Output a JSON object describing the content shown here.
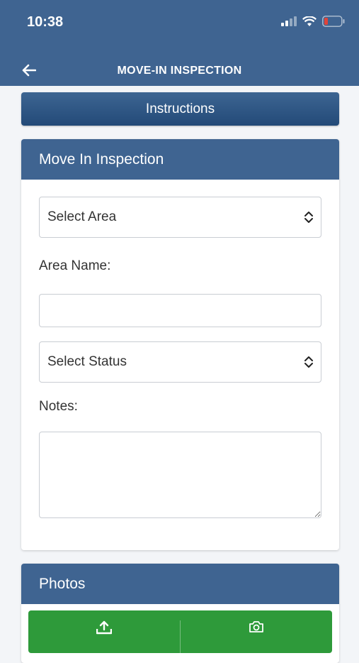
{
  "status_bar": {
    "time": "10:38"
  },
  "nav": {
    "title": "MOVE-IN INSPECTION",
    "back_icon": "back-arrow-icon"
  },
  "instructions_label": "Instructions",
  "inspection": {
    "title": "Move In Inspection",
    "area_select_value": "Select Area",
    "area_name_label": "Area Name:",
    "area_name_value": "",
    "status_select_value": "Select Status",
    "notes_label": "Notes:",
    "notes_value": ""
  },
  "photos": {
    "title": "Photos",
    "upload_icon": "upload-icon",
    "camera_icon": "camera-icon"
  },
  "colors": {
    "header": "#3f6491",
    "button_gradient_top": "#3d6592",
    "button_gradient_bottom": "#234a78",
    "photo_bar": "#2e9a3a",
    "background": "#f3f5f8"
  }
}
